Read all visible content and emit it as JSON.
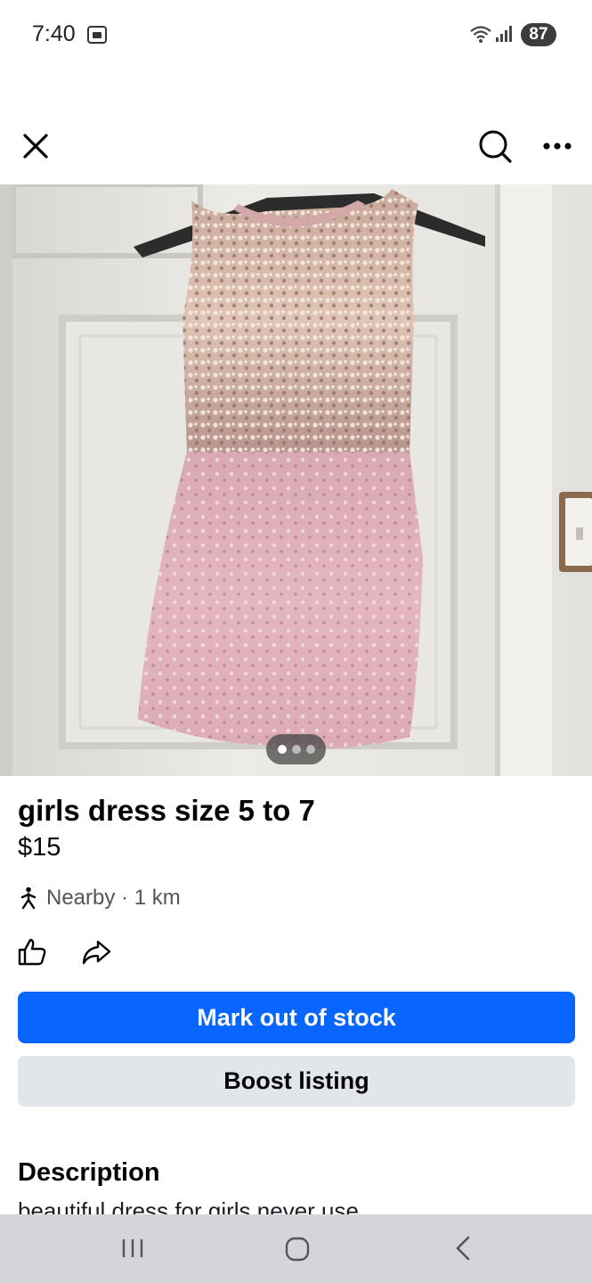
{
  "status_bar": {
    "time": "7:40",
    "battery": "87",
    "icons": [
      "screenshot-icon",
      "wifi-icon",
      "signal-icon",
      "battery-icon"
    ]
  },
  "top_bar": {
    "icons": [
      "close-icon",
      "search-icon",
      "more-icon"
    ]
  },
  "photo": {
    "subject": "pink sequin dress on hanger",
    "page_count": 3,
    "active_page": 1
  },
  "listing": {
    "title": "girls dress size 5 to 7",
    "price": "$15",
    "location": "Nearby · 1 km"
  },
  "actions": {
    "icons": [
      "like-icon",
      "share-icon"
    ]
  },
  "buttons": {
    "mark_out_of_stock": "Mark out of stock",
    "boost_listing": "Boost listing"
  },
  "description": {
    "heading": "Description",
    "text": "beautiful dress for girls never use"
  },
  "colors": {
    "primary": "#0866ff",
    "secondary_button": "#e2e5e9",
    "nav_bar": "#d4d5d9",
    "text": "#050505"
  },
  "nav_bar": {
    "icons": [
      "recents-icon",
      "home-icon",
      "back-icon"
    ]
  }
}
